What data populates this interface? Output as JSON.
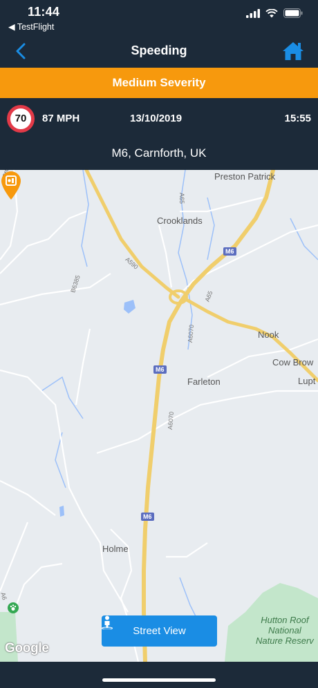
{
  "status_bar": {
    "time": "11:44",
    "back_app": "◀ TestFlight"
  },
  "nav": {
    "title": "Speeding"
  },
  "severity": {
    "label": "Medium Severity",
    "color": "#f7990d"
  },
  "event": {
    "limit": "70",
    "speed": "87 MPH",
    "date": "13/10/2019",
    "time": "15:55",
    "location": "M6, Carnforth, UK"
  },
  "map": {
    "places": [
      "Preston Patrick",
      "Crooklands",
      "Nook",
      "Cow Brow",
      "Lupt",
      "Farleton",
      "Holme",
      "Brow"
    ],
    "roads": [
      "M6",
      "A590",
      "A65",
      "A6070",
      "B6385",
      "A6"
    ],
    "park": [
      "Hutton Roof",
      "National",
      "Nature Reserv"
    ],
    "attribution": "Google"
  },
  "street_view": {
    "label": "Street View"
  },
  "colors": {
    "header": "#1c2a39",
    "accent": "#1a8de4",
    "limit_ring": "#e23a48"
  }
}
